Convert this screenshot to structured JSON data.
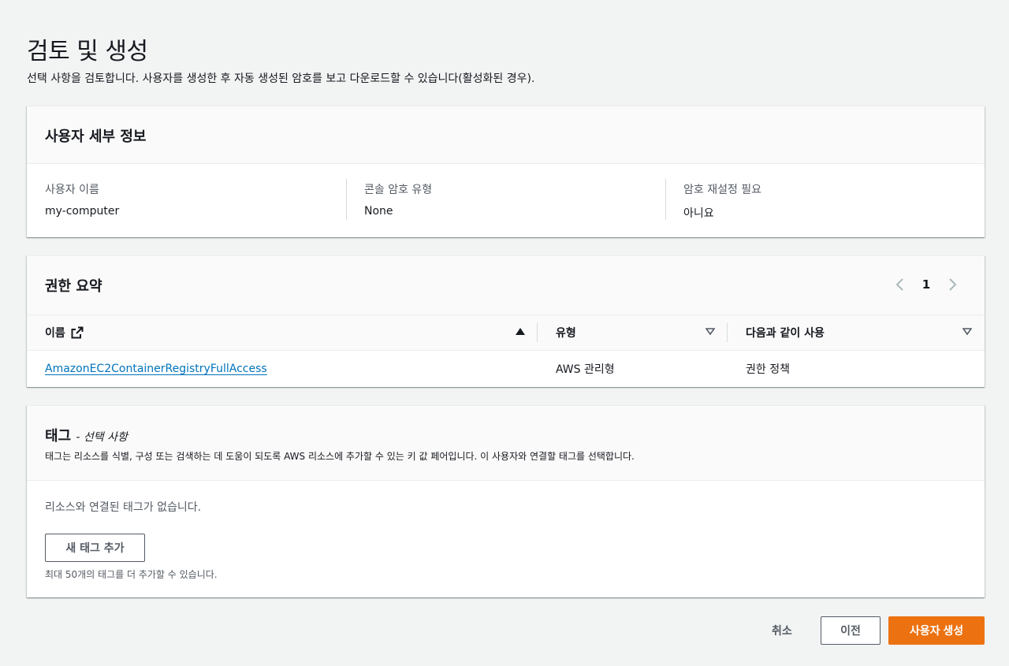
{
  "page": {
    "title": "검토 및 생성",
    "description": "선택 사항을 검토합니다. 사용자를 생성한 후 자동 생성된 암호를 보고 다운로드할 수 있습니다(활성화된 경우)."
  },
  "user_details": {
    "title": "사용자 세부 정보",
    "fields": [
      {
        "label": "사용자 이름",
        "value": "my-computer"
      },
      {
        "label": "콘솔 암호 유형",
        "value": "None"
      },
      {
        "label": "암호 재설정 필요",
        "value": "아니요"
      }
    ]
  },
  "permissions": {
    "title": "권한 요약",
    "page": "1",
    "columns": [
      "이름",
      "유형",
      "다음과 같이 사용"
    ],
    "rows": [
      {
        "name": "AmazonEC2ContainerRegistryFullAccess",
        "type": "AWS 관리형",
        "used_as": "권한 정책"
      }
    ]
  },
  "tags": {
    "title": "태그",
    "optional": "- 선택 사항",
    "description": "태그는 리소스를 식별, 구성 또는 검색하는 데 도움이 되도록 AWS 리소스에 추가할 수 있는 키 값 페어입니다. 이 사용자와 연결할 태그를 선택합니다.",
    "empty_text": "리소스와 연결된 태그가 없습니다.",
    "add_button": "새 태그 추가",
    "limit_note": "최대 50개의 태그를 더 추가할 수 있습니다."
  },
  "footer": {
    "cancel": "취소",
    "previous": "이전",
    "create": "사용자 생성"
  },
  "colors": {
    "primary": "#ec7211",
    "link": "#0073bb",
    "background": "#f2f3f3"
  }
}
